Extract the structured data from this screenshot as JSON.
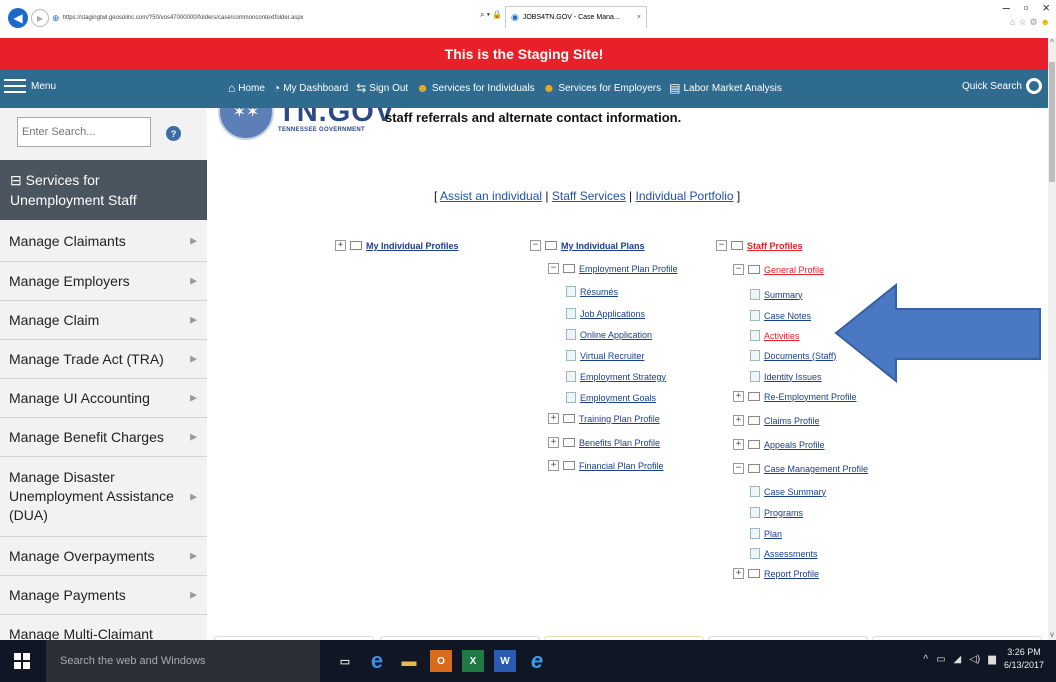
{
  "browser": {
    "url": "https://stagingtwl.geosolinc.com/?50/vos47000000/folders/case/commoncontextfolder.aspx",
    "url_tools": "⌕ ▾ 🔒 ↻",
    "tab_title": "JOBS4TN.GOV - Case Mana...",
    "tab_close": "×"
  },
  "banner": "This is the Staging Site!",
  "topnav": {
    "menu": "Menu",
    "links": [
      "Home",
      "My Dashboard",
      "Sign Out",
      "Services for Individuals",
      "Services for Employers",
      "Labor Market Analysis"
    ],
    "quick_search": "Quick Search"
  },
  "sidebar": {
    "search_placeholder": "Enter Search...",
    "help": "?",
    "section_title": "⊟ Services for Unemployment Staff",
    "items": [
      "Manage Claimants",
      "Manage Employers",
      "Manage Claim",
      "Manage Trade Act (TRA)",
      "Manage UI Accounting",
      "Manage Benefit Charges",
      "Manage Disaster Unemployment Assistance (DUA)",
      "Manage Overpayments",
      "Manage Payments",
      "Manage Multi-Claimant"
    ]
  },
  "logo": {
    "text": "TN.GOV",
    "sub": "TENNESSEE GOVERNMENT",
    "caption": "staff referrals and alternate contact information."
  },
  "assist": {
    "open": "[",
    "close": "]",
    "sep": "|",
    "links": [
      "Assist an individual",
      "Staff Services",
      "Individual Portfolio"
    ]
  },
  "tree": {
    "profiles": "My Individual Profiles",
    "plans": "My Individual Plans",
    "plan_items": [
      "Employment Plan Profile",
      "Résumés",
      "Job Applications",
      "Online Application",
      "Virtual Recruiter",
      "Employment Strategy",
      "Employment Goals",
      "Training Plan Profile",
      "Benefits Plan Profile",
      "Financial Plan Profile"
    ],
    "staff": "Staff Profiles",
    "staff_items": [
      "General Profile",
      "Summary",
      "Case Notes",
      "Activities",
      "Documents (Staff)",
      "Identity Issues",
      "Re-Employment Profile",
      "Claims Profile",
      "Appeals Profile",
      "Case Management Profile",
      "Case Summary",
      "Programs",
      "Plan",
      "Assessments",
      "Report Profile"
    ]
  },
  "taskbar": {
    "search": "Search the web and Windows",
    "time": "3:26 PM",
    "date": "6/13/2017"
  },
  "colors": {
    "banner": "#e8202b",
    "nav": "#2e6b8f",
    "sidebar_head": "#4a5560",
    "arrow": "#4a78c2"
  }
}
